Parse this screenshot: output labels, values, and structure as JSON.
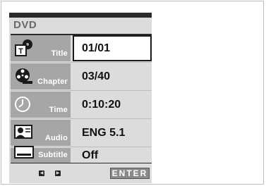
{
  "menu": {
    "header": "DVD",
    "items": [
      {
        "label": "Title",
        "value": "01/01",
        "icon": "title-disc-icon"
      },
      {
        "label": "Chapter",
        "value": "03/40",
        "icon": "chapter-film-icon"
      },
      {
        "label": "Time",
        "value": "0:10:20",
        "icon": "clock-icon"
      },
      {
        "label": "Audio",
        "value": "ENG 5.1",
        "icon": "audio-speaker-icon"
      },
      {
        "label": "Subtitle",
        "value": "Off",
        "icon": "subtitle-screen-icon"
      }
    ],
    "footer": {
      "enter_label": "ENTER",
      "nav_icons": [
        "left-arrow-icon",
        "right-arrow-icon"
      ]
    }
  },
  "colors": {
    "background": "#ffffff",
    "panel": "#dcdcdc",
    "label_box": "#a6a6a6",
    "dark": "#2a2a2a"
  }
}
